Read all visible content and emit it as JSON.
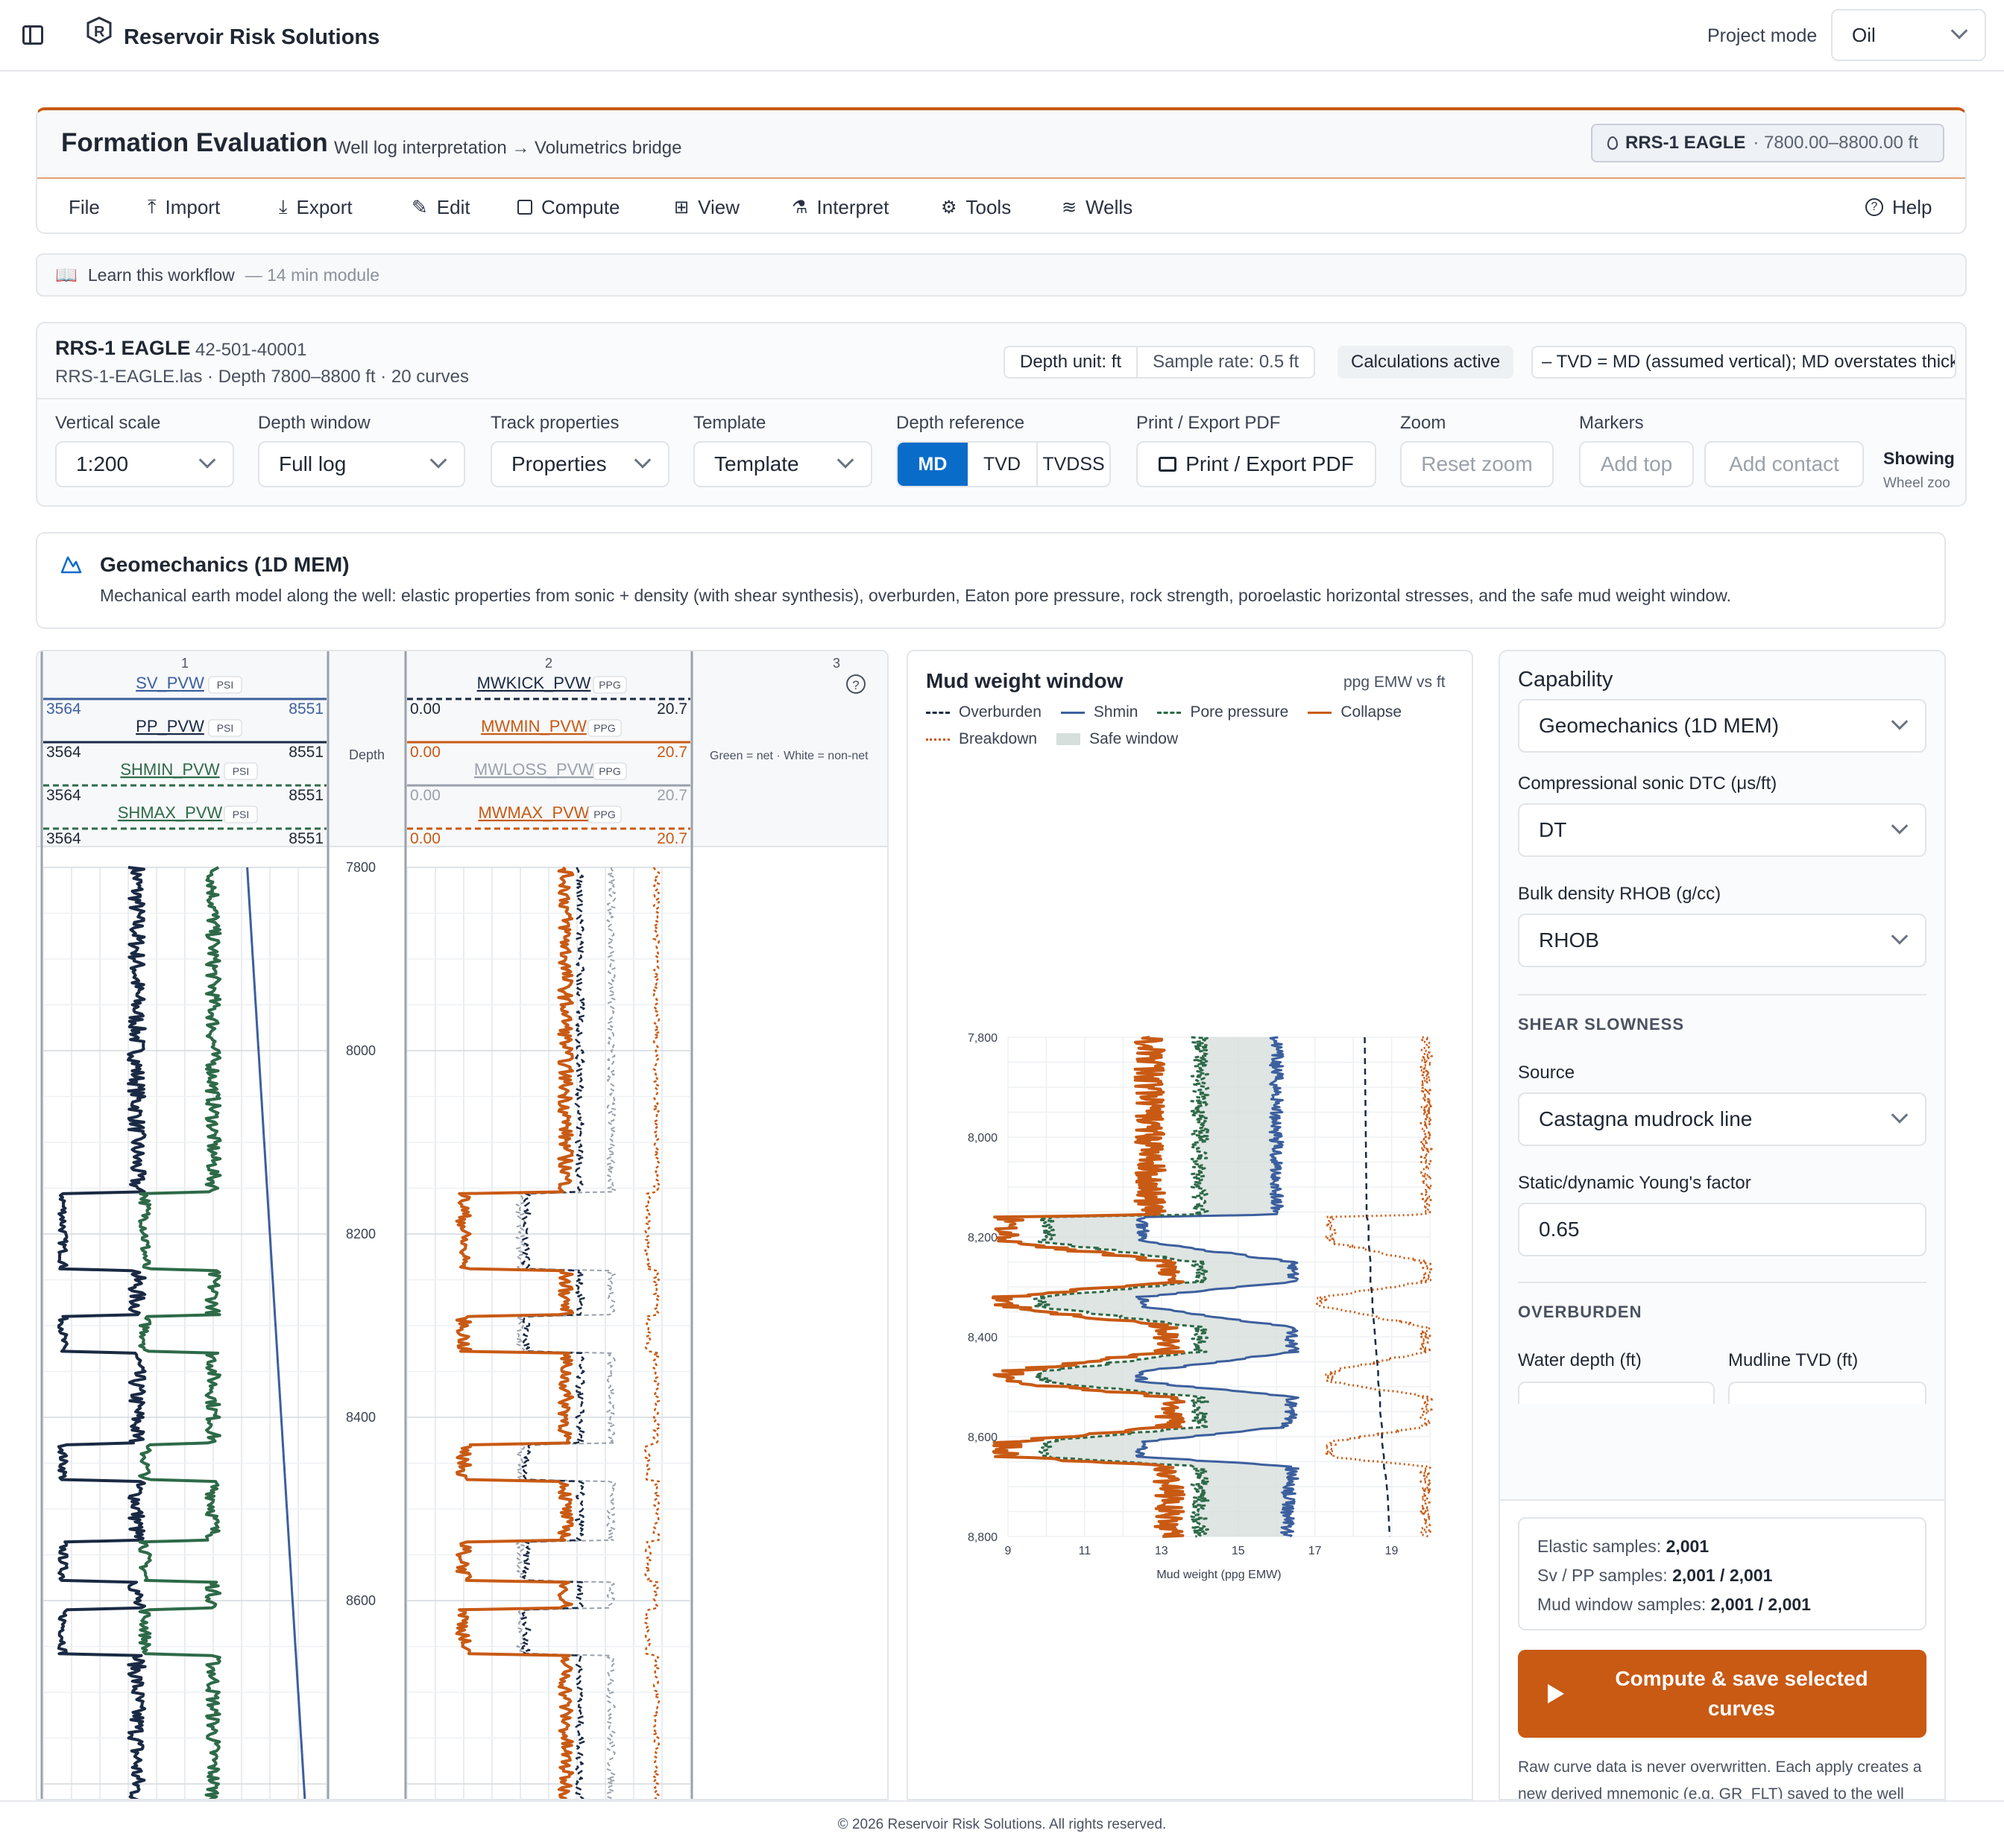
{
  "app": {
    "title": "Reservoir Risk Solutions",
    "project_mode_label": "Project mode",
    "project_mode_value": "Oil"
  },
  "header": {
    "title": "Formation Evaluation",
    "subtitle": "Well log interpretation → Volumetrics bridge",
    "well_badge": "RRS-1 EAGLE",
    "well_range": "· 7800.00–8800.00 ft"
  },
  "menu": {
    "items": [
      "File",
      "Import",
      "Export",
      "Edit",
      "Compute",
      "View",
      "Interpret",
      "Tools",
      "Wells"
    ],
    "help": "Help"
  },
  "learn": {
    "text": "Learn this workflow",
    "duration": "— 14 min module"
  },
  "well": {
    "name": "RRS-1 EAGLE",
    "api": "42-501-40001",
    "file": "RRS-1-EAGLE.las · Depth 7800–8800 ft · 20 curves",
    "depth_unit": "Depth unit: ft",
    "sample_rate": "Sample rate: 0.5 ft",
    "calc": "Calculations active",
    "note": "– TVD = MD (assumed vertical); MD overstates thick"
  },
  "toolbar": {
    "vertical_scale_label": "Vertical scale",
    "vertical_scale_value": "1:200",
    "depth_window_label": "Depth window",
    "depth_window_value": "Full log",
    "track_props_label": "Track properties",
    "track_props_value": "Properties",
    "template_label": "Template",
    "template_value": "Template",
    "depth_ref_label": "Depth reference",
    "depth_ref_options": [
      "MD",
      "TVD",
      "TVDSS"
    ],
    "print_label": "Print / Export PDF",
    "print_button": "Print / Export PDF",
    "zoom_label": "Zoom",
    "zoom_button": "Reset zoom",
    "markers_label": "Markers",
    "add_top": "Add top",
    "add_contact": "Add contact",
    "showing": "Showing",
    "wheel": "Wheel zoo"
  },
  "geomech": {
    "title": "Geomechanics (1D MEM)",
    "description": "Mechanical earth model along the well: elastic properties from sonic + density (with shear synthesis), overburden, Eaton pore pressure, rock strength, poroelastic horizontal stresses, and the safe mud weight window."
  },
  "tracks": {
    "t1": {
      "num": "1",
      "curves": [
        {
          "name": "SV_PVW",
          "unit": "PSI",
          "min": "3564",
          "max": "8551",
          "color": "#3c5f9e"
        },
        {
          "name": "PP_PVW",
          "unit": "PSI",
          "min": "3564",
          "max": "8551",
          "color": "#1a2a44"
        },
        {
          "name": "SHMIN_PVW",
          "unit": "PSI",
          "min": "3564",
          "max": "8551",
          "color": "#2e6a48"
        },
        {
          "name": "SHMAX_PVW",
          "unit": "PSI",
          "min": "3564",
          "max": "8551",
          "color": "#2e6a48"
        }
      ]
    },
    "depth": {
      "label": "Depth",
      "ticks": [
        "7800",
        "8000",
        "8200",
        "8400",
        "8600"
      ]
    },
    "t2": {
      "num": "2",
      "curves": [
        {
          "name": "MWKICK_PVW",
          "unit": "PPG",
          "min": "0.00",
          "max": "20.7",
          "color": "#1a2a44"
        },
        {
          "name": "MWMIN_PVW",
          "unit": "PPG",
          "min": "0.00",
          "max": "20.7",
          "color": "#c85a14"
        },
        {
          "name": "MWLOSS_PVW",
          "unit": "PPG",
          "min": "0.00",
          "max": "20.7",
          "color": "#9aa1ab"
        },
        {
          "name": "MWMAX_PVW",
          "unit": "PPG",
          "min": "0.00",
          "max": "20.7",
          "color": "#c85a14"
        }
      ]
    },
    "t3": {
      "num": "3",
      "note": "Green = net · White = non-net"
    }
  },
  "mudwindow": {
    "title": "Mud weight window",
    "units": "ppg EMW vs ft",
    "legend": [
      {
        "name": "Overburden",
        "style": "dash",
        "color": "#1a2a44"
      },
      {
        "name": "Shmin",
        "style": "solid",
        "color": "#3c5f9e"
      },
      {
        "name": "Pore pressure",
        "style": "dash",
        "color": "#2e6a48"
      },
      {
        "name": "Collapse",
        "style": "solid",
        "color": "#c85a14"
      },
      {
        "name": "Breakdown",
        "style": "dot",
        "color": "#c85a14"
      },
      {
        "name": "Safe window",
        "style": "box",
        "color": "#d6dfdb"
      }
    ]
  },
  "chart_data": {
    "type": "line",
    "title": "Mud weight window",
    "xlabel": "Mud weight (ppg EMW)",
    "ylabel": "",
    "x_ticks": [
      "9",
      "11",
      "13",
      "15",
      "17",
      "19"
    ],
    "y_ticks": [
      "7,800",
      "8,000",
      "8,200",
      "8,400",
      "8,600",
      "8,800"
    ],
    "xlim": [
      9,
      20
    ],
    "ylim": [
      7800,
      8800
    ],
    "y_inverted": true,
    "depth": [
      7800,
      8155,
      8160,
      8170,
      8210,
      8250,
      8290,
      8320,
      8340,
      8380,
      8430,
      8470,
      8490,
      8520,
      8550,
      8580,
      8610,
      8640,
      8660,
      8680,
      8720,
      8800
    ],
    "series": [
      {
        "name": "Overburden",
        "values": [
          18.3,
          18.35,
          18.35,
          18.4,
          18.4,
          18.45,
          18.45,
          18.5,
          18.5,
          18.55,
          18.6,
          18.65,
          18.65,
          18.7,
          18.7,
          18.75,
          18.75,
          18.8,
          18.8,
          18.85,
          18.9,
          18.95
        ]
      },
      {
        "name": "Shmin",
        "values": [
          16.0,
          16.0,
          12.5,
          12.5,
          12.6,
          16.4,
          16.4,
          12.5,
          12.5,
          16.4,
          16.4,
          12.5,
          12.5,
          16.4,
          16.4,
          16.3,
          12.5,
          12.5,
          16.4,
          16.4,
          16.3,
          16.3
        ]
      },
      {
        "name": "Pore pressure",
        "values": [
          14.0,
          14.0,
          10.0,
          10.0,
          10.0,
          14.0,
          14.0,
          9.9,
          9.9,
          14.0,
          14.0,
          9.9,
          9.9,
          14.0,
          14.0,
          14.0,
          9.9,
          9.9,
          14.0,
          14.0,
          14.0,
          14.0
        ]
      },
      {
        "name": "Collapse",
        "values": [
          12.7,
          12.7,
          9.0,
          9.0,
          9.0,
          13.2,
          13.2,
          9.0,
          9.0,
          13.2,
          13.2,
          9.0,
          9.0,
          13.2,
          13.2,
          13.2,
          9.0,
          9.0,
          13.2,
          13.2,
          13.2,
          13.2
        ]
      },
      {
        "name": "Breakdown",
        "values": [
          19.9,
          19.9,
          17.4,
          17.4,
          17.4,
          19.9,
          19.9,
          17.2,
          17.2,
          19.9,
          19.9,
          17.4,
          17.4,
          19.9,
          19.9,
          19.9,
          17.4,
          17.4,
          19.9,
          19.9,
          19.9,
          19.9
        ]
      }
    ]
  },
  "capability": {
    "title": "Capability",
    "value": "Geomechanics (1D MEM)",
    "dtc_label": "Compressional sonic DTC (μs/ft)",
    "dtc_value": "DT",
    "rhob_label": "Bulk density RHOB (g/cc)",
    "rhob_value": "RHOB",
    "shear_section": "SHEAR SLOWNESS",
    "source_label": "Source",
    "source_value": "Castagna mudrock line",
    "young_label": "Static/dynamic Young's factor",
    "young_value": "0.65",
    "overburden_section": "OVERBURDEN",
    "water_depth_label": "Water depth (ft)",
    "mudline_label": "Mudline TVD (ft)",
    "stats": [
      {
        "label": "Elastic samples: ",
        "value": "2,001"
      },
      {
        "label": "Sv / PP samples: ",
        "value": "2,001 / 2,001"
      },
      {
        "label": "Mud window samples: ",
        "value": "2,001 / 2,001"
      }
    ],
    "compute_button": "Compute & save selected curves",
    "footnote": "Raw curve data is never overwritten. Each apply creates a new derived mnemonic (e.g. GR_FLT) saved to the well and project file with a timestamped audit"
  },
  "footer": {
    "text": "© 2026 Reservoir Risk Solutions. All rights reserved."
  },
  "colors": {
    "accent": "#c85a14",
    "primary": "#0a6cc9",
    "navy": "#1a2a44",
    "green": "#2e6a48",
    "blue": "#3c5f9e"
  }
}
